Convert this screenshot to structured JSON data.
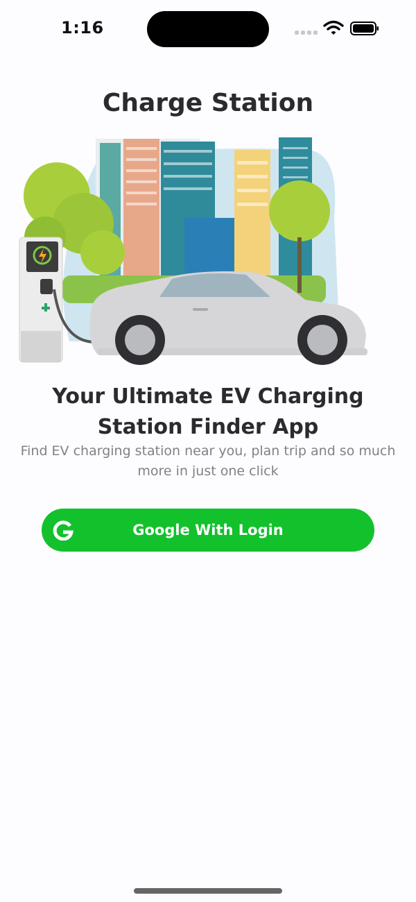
{
  "status_bar": {
    "time": "1:16"
  },
  "app": {
    "title": "Charge Station"
  },
  "onboarding": {
    "headline": "Your Ultimate EV Charging Station Finder App",
    "subtitle": "Find EV charging station near you, plan trip and so much more in just one click",
    "illustration": "ev-car-charging-city-illustration"
  },
  "login": {
    "google_label": "Google With Login",
    "icon": "google-g-icon"
  },
  "colors": {
    "accent": "#12c12c",
    "title": "#2b2b2d",
    "subtitle": "#808088",
    "background": "#fdfcfe"
  }
}
